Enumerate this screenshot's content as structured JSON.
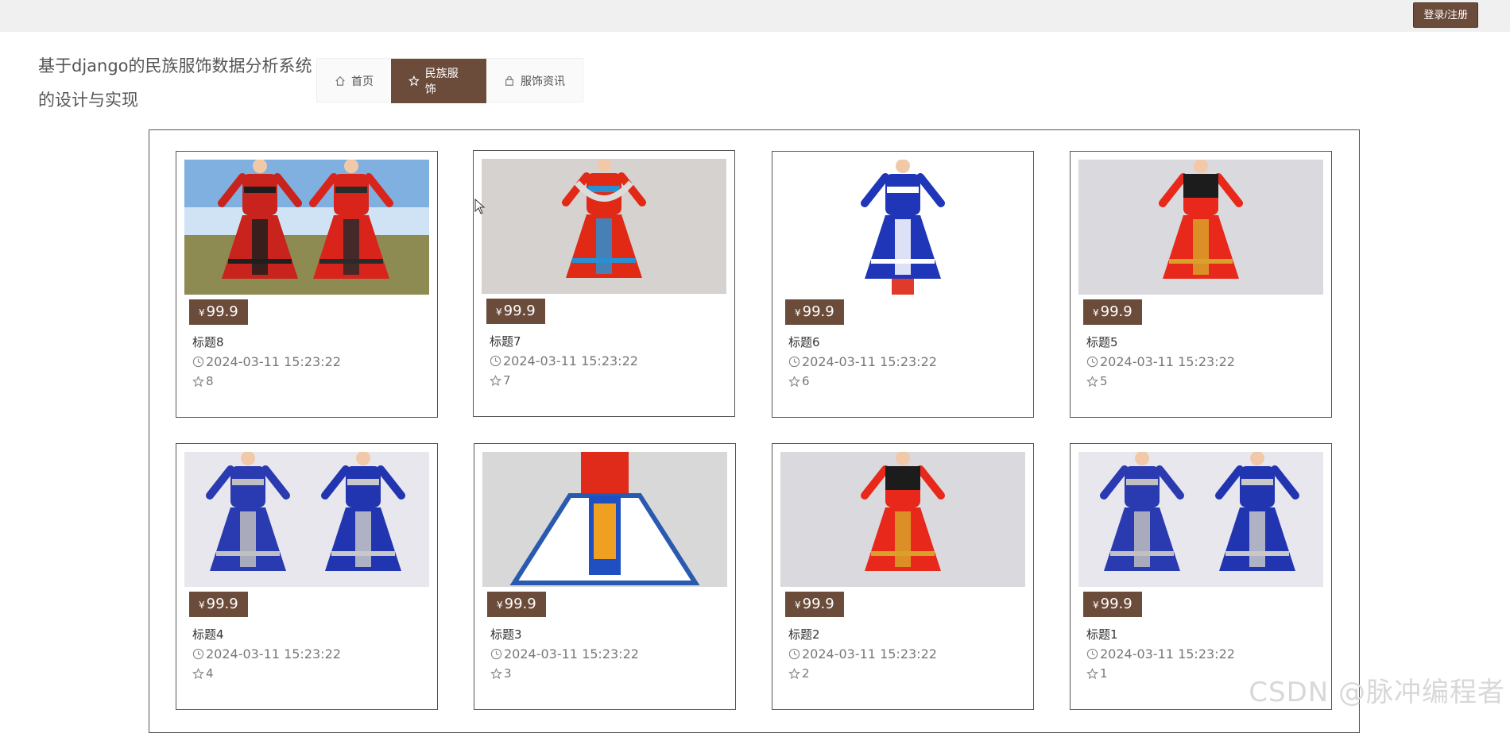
{
  "header": {
    "login_label": "登录/注册"
  },
  "site": {
    "title": "基于django的民族服饰数据分析系统的设计与实现"
  },
  "nav": {
    "items": [
      {
        "label": "首页",
        "icon": "home-icon",
        "active": false
      },
      {
        "label": "民族服饰",
        "icon": "star-icon",
        "active": true
      },
      {
        "label": "服饰资讯",
        "icon": "bag-icon",
        "active": false
      }
    ]
  },
  "cards": [
    {
      "title": "标题8",
      "currency": "¥",
      "price": "99.9",
      "date": "2024-03-11 15:23:22",
      "likes": "8"
    },
    {
      "title": "标题7",
      "currency": "¥",
      "price": "99.9",
      "date": "2024-03-11 15:23:22",
      "likes": "7"
    },
    {
      "title": "标题6",
      "currency": "¥",
      "price": "99.9",
      "date": "2024-03-11 15:23:22",
      "likes": "6"
    },
    {
      "title": "标题5",
      "currency": "¥",
      "price": "99.9",
      "date": "2024-03-11 15:23:22",
      "likes": "5"
    },
    {
      "title": "标题4",
      "currency": "¥",
      "price": "99.9",
      "date": "2024-03-11 15:23:22",
      "likes": "4"
    },
    {
      "title": "标题3",
      "currency": "¥",
      "price": "99.9",
      "date": "2024-03-11 15:23:22",
      "likes": "3"
    },
    {
      "title": "标题2",
      "currency": "¥",
      "price": "99.9",
      "date": "2024-03-11 15:23:22",
      "likes": "2"
    },
    {
      "title": "标题1",
      "currency": "¥",
      "price": "99.9",
      "date": "2024-03-11 15:23:22",
      "likes": "1"
    }
  ],
  "watermark": "CSDN @脉冲编程者",
  "colors": {
    "accent": "#6b4c3b",
    "topbar": "#f0f0f0"
  }
}
